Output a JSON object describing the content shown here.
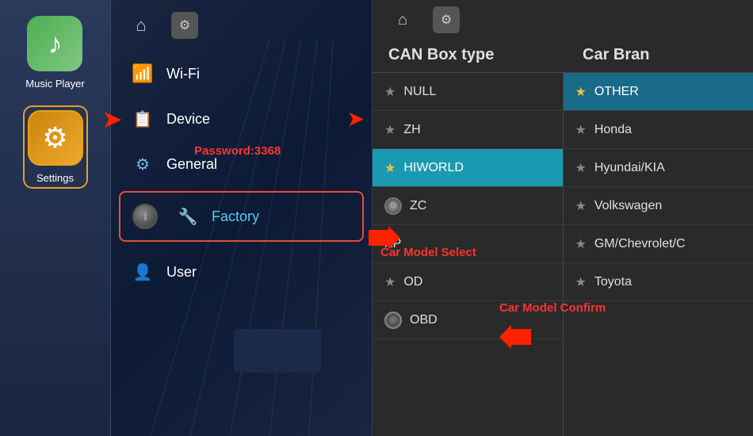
{
  "sidebar": {
    "music_player": {
      "label": "Music Player",
      "icon": "♪"
    },
    "settings": {
      "label": "Settings",
      "icon": "⚙"
    }
  },
  "middle": {
    "top_bar": {
      "home_icon": "⌂",
      "settings_icon": "⚙"
    },
    "password_text": "Password:3368",
    "menu_items": [
      {
        "id": "wifi",
        "label": "Wi-Fi",
        "icon": "wifi"
      },
      {
        "id": "device",
        "label": "Device",
        "icon": "device"
      },
      {
        "id": "general",
        "label": "General",
        "icon": "general"
      },
      {
        "id": "factory",
        "label": "Factory",
        "icon": "factory",
        "active": true
      },
      {
        "id": "user",
        "label": "User",
        "icon": "user"
      }
    ],
    "annotations": {
      "password": "Password:3368",
      "car_model_select": "Car Model Select",
      "car_model_confirm": "Car Model Confirm"
    }
  },
  "right": {
    "top_bar": {
      "home_icon": "⌂",
      "settings_icon": "⚙"
    },
    "columns": {
      "can_box_type": "CAN Box type",
      "car_brand": "Car Bran"
    },
    "can_items": [
      {
        "id": "null",
        "label": "NULL",
        "star": false
      },
      {
        "id": "zh",
        "label": "ZH",
        "star": false
      },
      {
        "id": "hiworld",
        "label": "HIWORLD",
        "star": true,
        "highlighted": true
      },
      {
        "id": "zc",
        "label": "ZC",
        "star": false,
        "gear": true
      },
      {
        "id": "xp",
        "label": "XP",
        "star": false
      },
      {
        "id": "od",
        "label": "OD",
        "star": false
      },
      {
        "id": "obd",
        "label": "OBD",
        "star": false,
        "obd": true
      }
    ],
    "brand_items": [
      {
        "id": "other",
        "label": "OTHER",
        "star": true,
        "active": true
      },
      {
        "id": "honda",
        "label": "Honda",
        "star": false
      },
      {
        "id": "hyundai",
        "label": "Hyundai/KIA",
        "star": false
      },
      {
        "id": "volkswagen",
        "label": "Volkswagen",
        "star": false
      },
      {
        "id": "gm",
        "label": "GM/Chevrolet/C",
        "star": false
      },
      {
        "id": "toyota",
        "label": "Toyota",
        "star": false
      }
    ]
  }
}
